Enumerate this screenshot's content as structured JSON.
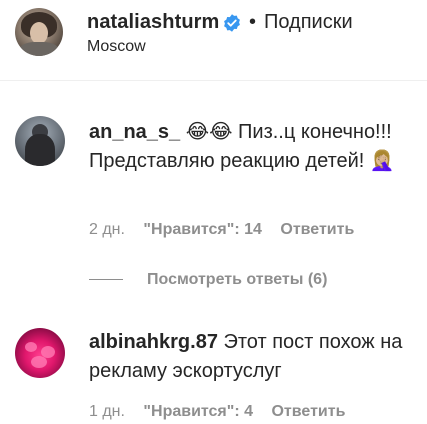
{
  "header": {
    "username": "nataliashturm",
    "dot": "•",
    "follow_label": "Подписки",
    "location": "Moscow",
    "verified_color": "#3897f0"
  },
  "comments": [
    {
      "username": "an_na_s_",
      "text": "😂😂 Пиз..ц конечно!!! Представляю реакцию детей! 🤦🏼‍♀️",
      "time": "2 дн.",
      "likes": "\"Нравится\": 14",
      "reply": "Ответить",
      "view_replies": "Посмотреть ответы (6)"
    },
    {
      "username": "albinahkrg.87",
      "text": "Этот пост похож на рекламу эскортуслуг",
      "time": "1 дн.",
      "likes": "\"Нравится\": 4",
      "reply": "Ответить"
    }
  ]
}
